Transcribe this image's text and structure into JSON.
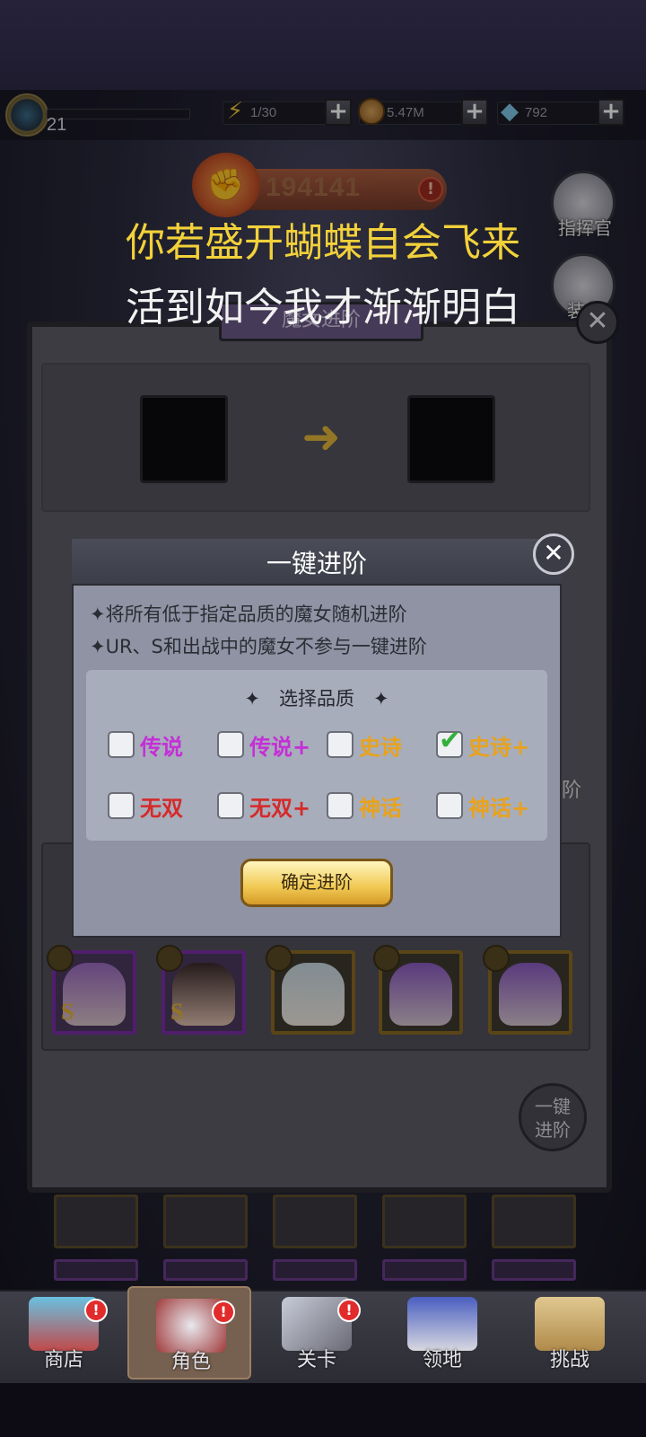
{
  "resources": {
    "level": "21",
    "stamina": "1/30",
    "gold": "5.47M",
    "gems": "792"
  },
  "power": {
    "value": "194141"
  },
  "lyrics": {
    "line1": "你若盛开蝴蝶自会飞来",
    "line2": "活到如今我才渐渐明白"
  },
  "side_buttons": {
    "commander": "指挥官",
    "equipment": "装备"
  },
  "back_panel": {
    "title": "魔女进阶",
    "side_text": "阶",
    "round_button": [
      "一键",
      "进阶"
    ]
  },
  "modal": {
    "title": "一键进阶",
    "notes": [
      "✦将所有低于指定品质的魔女随机进阶",
      "✦UR、S和出战中的魔女不参与一键进阶"
    ],
    "quality_title": "✦　选择品质　✦",
    "options": [
      {
        "label": "传说",
        "checked": false,
        "color": "#c42fd6"
      },
      {
        "label": "传说+",
        "checked": false,
        "color": "#c42fd6"
      },
      {
        "label": "史诗",
        "checked": false,
        "color": "#e8a21c"
      },
      {
        "label": "史诗+",
        "checked": true,
        "color": "#e8a21c"
      },
      {
        "label": "无双",
        "checked": false,
        "color": "#d52a2a"
      },
      {
        "label": "无双+",
        "checked": false,
        "color": "#d52a2a"
      },
      {
        "label": "神话",
        "checked": false,
        "color": "#e8a21c"
      },
      {
        "label": "神话+",
        "checked": false,
        "color": "#e8a21c"
      }
    ],
    "confirm": "确定进阶"
  },
  "cards": [
    {
      "rank": "S",
      "border": "#7b2fa8"
    },
    {
      "rank": "S",
      "border": "#7b2fa8"
    },
    {
      "rank": "",
      "border": "#8b6a22"
    },
    {
      "rank": "",
      "border": "#8b6a22"
    },
    {
      "rank": "",
      "border": "#8b6a22"
    }
  ],
  "nav": [
    {
      "label": "商店",
      "badge": "!"
    },
    {
      "label": "角色",
      "badge": "!"
    },
    {
      "label": "关卡",
      "badge": "!"
    },
    {
      "label": "领地",
      "badge": ""
    },
    {
      "label": "挑战",
      "badge": ""
    }
  ],
  "colors": {
    "accent_gold": "#f2d13a",
    "modal_bg": "#8f93a3",
    "check_green": "#34b03a"
  }
}
